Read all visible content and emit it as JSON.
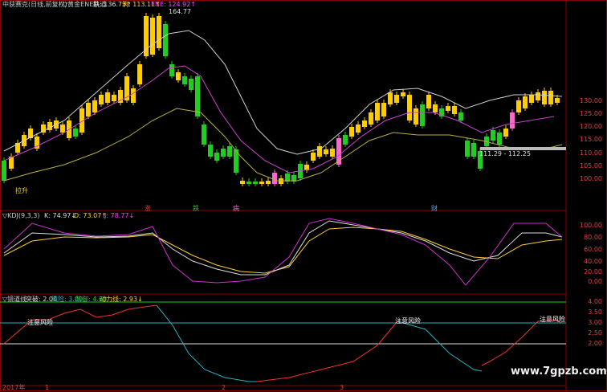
{
  "header": {
    "main_title": "中获赛克(日线,前复权)",
    "indicator_name": "▽黄金ENE轨道",
    "upper_label": "跌: 136.73↑",
    "mid_label": "筑: 113.11↑",
    "ene_label": "ENE: 124.92↑"
  },
  "main_chart": {
    "high_marker": "164.77",
    "range_text": "111.29 - 112.25",
    "left_tag": "拉升",
    "y_ticks": [
      "130.00",
      "125.00",
      "120.00",
      "115.00",
      "110.00",
      "105.00",
      "100.00"
    ],
    "bottom_tags": [
      "涨",
      "跌",
      "病",
      "财"
    ],
    "colors": {
      "up": "#ffcc00",
      "down": "#22cc22",
      "pink": "#ff66cc",
      "upper": "#cfcfcf",
      "mid": "#cc44cc",
      "lower": "#b8b040"
    }
  },
  "kdj": {
    "title": "▽KDJ(9,3,3)",
    "k_label": "K: 74.97↓",
    "d_label": "D: 73.07↑",
    "j_label": "J: 78.77↓",
    "y_ticks": [
      "100.00",
      "80.00",
      "60.00",
      "40.00",
      "20.00",
      "0.00"
    ]
  },
  "lower": {
    "title": "▽镜道线",
    "l1": "突破: 2.00",
    "l2": "风险: 3.00",
    "l3": "防御: 4.00",
    "l4": "动力线: 2.93↓",
    "annotation": "注意风险",
    "y_ticks": [
      "4.00",
      "3.50",
      "3.00",
      "2.50",
      "2.00"
    ]
  },
  "footer": {
    "year": "2017年",
    "m1": "1",
    "m2": "2",
    "m3": "3"
  },
  "watermark": "www.7gpzb.com"
}
